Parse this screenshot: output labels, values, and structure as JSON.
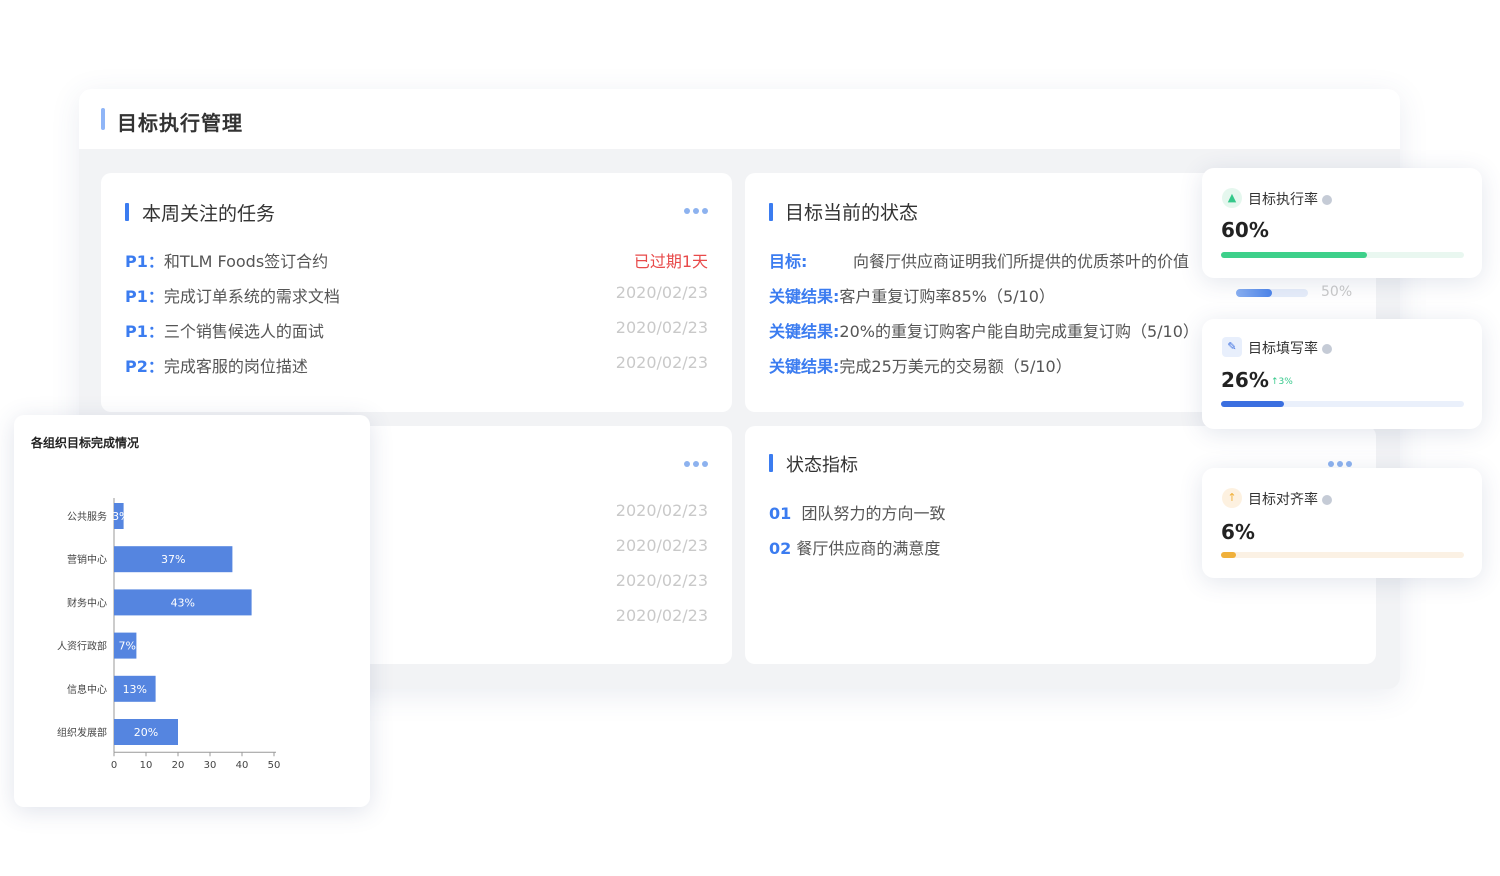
{
  "header": {
    "title": "目标执行管理"
  },
  "tasks_card": {
    "title": "本周关注的任务",
    "items": [
      {
        "priority": "P1：",
        "text": "和TLM Foods签订合约",
        "date": "已过期1天",
        "overdue": true
      },
      {
        "priority": "P1：",
        "text": "完成订单系统的需求文档",
        "date": "2020/02/23",
        "overdue": false
      },
      {
        "priority": "P1：",
        "text": "三个销售候选人的面试",
        "date": "2020/02/23",
        "overdue": false
      },
      {
        "priority": "P2：",
        "text": "完成客服的岗位描述",
        "date": "2020/02/23",
        "overdue": false
      }
    ]
  },
  "status_card": {
    "title": "目标当前的状态",
    "goal_label": "目标:",
    "goal_text": "向餐厅供应商证明我们所提供的优质茶叶的价值",
    "key_results": [
      {
        "label": "关键结果:",
        "text": "客户重复订购率85%（5/10）"
      },
      {
        "label": "关键结果:",
        "text": "20%的重复订购客户能自助完成重复订购（5/10）"
      },
      {
        "label": "关键结果:",
        "text": "完成25万美元的交易额（5/10）"
      }
    ],
    "progress_text": "50%",
    "progress_value": 0.5
  },
  "lower_left_card": {
    "dates": [
      "2020/02/23",
      "2020/02/23",
      "2020/02/23",
      "2020/02/23"
    ]
  },
  "indicator_card": {
    "title": "状态指标",
    "items": [
      {
        "num": "01",
        "text": "团队努力的方向一致"
      },
      {
        "num": "02",
        "text": "餐厅供应商的满意度"
      }
    ]
  },
  "metrics": [
    {
      "label": "目标执行率",
      "value": "60%",
      "fraction": 0.6,
      "icon": "org-icon",
      "color": "#3dd08a",
      "track": "#e9f7f0",
      "delta": ""
    },
    {
      "label": "目标填写率",
      "value": "26%",
      "fraction": 0.26,
      "icon": "edit-icon",
      "color": "#3b6fe0",
      "track": "#eaf0fb",
      "delta": "↑3%"
    },
    {
      "label": "目标对齐率",
      "value": "6%",
      "fraction": 0.06,
      "icon": "align-icon",
      "color": "#f0b03a",
      "track": "#fbf1e4",
      "delta": ""
    }
  ],
  "chart_title": "各组织目标完成情况",
  "chart_data": {
    "type": "bar",
    "orientation": "horizontal",
    "title": "各组织目标完成情况",
    "categories": [
      "公共服务",
      "营销中心",
      "财务中心",
      "人资行政部",
      "信息中心",
      "组织发展部"
    ],
    "values": [
      3,
      37,
      43,
      7,
      13,
      20
    ],
    "value_labels": [
      "3%",
      "37%",
      "43%",
      "7%",
      "13%",
      "20%"
    ],
    "xlim": [
      0,
      50
    ],
    "xticks": [
      "0",
      "10",
      "20",
      "30",
      "40",
      "50"
    ],
    "bar_color": "#5585e0",
    "grid": false
  }
}
